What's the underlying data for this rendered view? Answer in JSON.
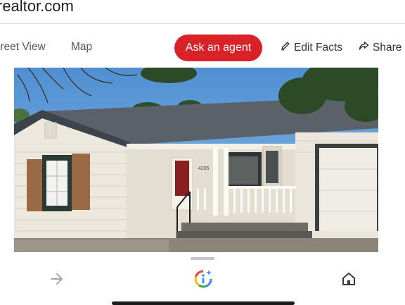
{
  "browser": {
    "url_text": "realtor.com"
  },
  "toolbar": {
    "street_view_label": "treet View",
    "map_label": "Map",
    "ask_agent_label": "Ask an agent",
    "edit_facts_label": "Edit Facts",
    "share_label": "Share t"
  },
  "listing_photo": {
    "house_number": "4205"
  },
  "bottom_nav": {
    "icons": [
      "forward-arrow-icon",
      "google-lens-icon",
      "home-icon"
    ]
  },
  "colors": {
    "accent": "#d92228",
    "sky": "#5a97d6",
    "siding": "#ece8de",
    "roof": "#5b6168"
  }
}
